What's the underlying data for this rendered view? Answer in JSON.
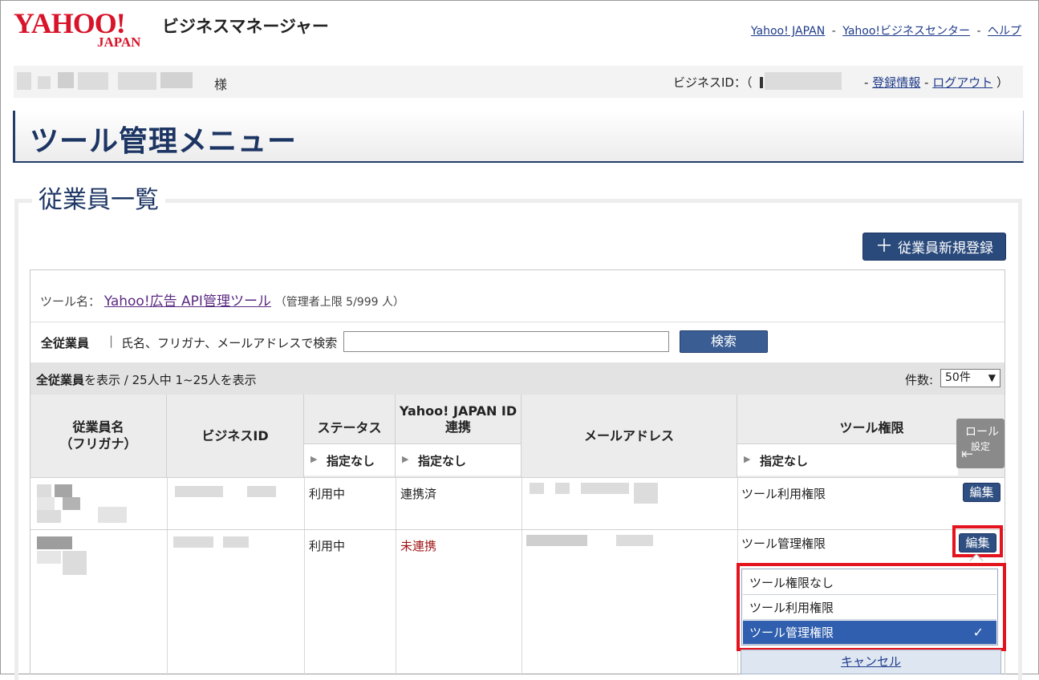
{
  "header": {
    "logo_main": "YAHOO!",
    "logo_sub": "JAPAN",
    "product": "ビジネスマネージャー",
    "links": [
      "Yahoo! JAPAN",
      "Yahoo!ビジネスセンター",
      "ヘルプ"
    ],
    "separator": "-"
  },
  "userbar": {
    "honorific": "様",
    "bizid_label": "ビジネスID：（",
    "dash": "-",
    "reg_info": "登録情報",
    "logout": "ログアウト",
    "close_paren": "）"
  },
  "page_title": "ツール管理メニュー",
  "section_title": "従業員一覧",
  "new_employee_button": "従業員新規登録",
  "tool": {
    "label": "ツール名：",
    "name": "Yahoo!広告 API管理ツール",
    "limit": "（管理者上限 5/999 人）"
  },
  "search": {
    "tab_all": "全従業員",
    "separator": "|",
    "label": "氏名、フリガナ、メールアドレスで検索",
    "input_value": "",
    "button": "検索"
  },
  "summary": {
    "bold": "全従業員",
    "text": "を表示 / 25人中 1~25人を表示",
    "count_label": "件数:",
    "count_value": "50件"
  },
  "columns": {
    "employee_line1": "従業員名",
    "employee_line2": "（フリガナ）",
    "bizid": "ビジネスID",
    "status": "ステータス",
    "yjid_line1": "Yahoo! JAPAN ID",
    "yjid_line2": "連携",
    "email": "メールアドレス",
    "permission": "ツール権限",
    "filter_unspecified": "指定なし"
  },
  "role_button": {
    "line1": "ロール",
    "line2": "設定"
  },
  "rows": [
    {
      "status": "利用中",
      "linked": "連携済",
      "permission": "ツール利用権限",
      "edit": "編集"
    },
    {
      "status": "利用中",
      "linked": "未連携",
      "permission": "ツール管理権限",
      "edit": "編集"
    }
  ],
  "dropdown": {
    "options": [
      "ツール権限なし",
      "ツール利用権限",
      "ツール管理権限"
    ],
    "selected_index": 2,
    "check": "✓",
    "cancel": "キャンセル"
  },
  "colors": {
    "brand_red": "#d8142a",
    "navy": "#1c3563",
    "highlight": "#e3141e",
    "selected": "#2f5fae"
  }
}
